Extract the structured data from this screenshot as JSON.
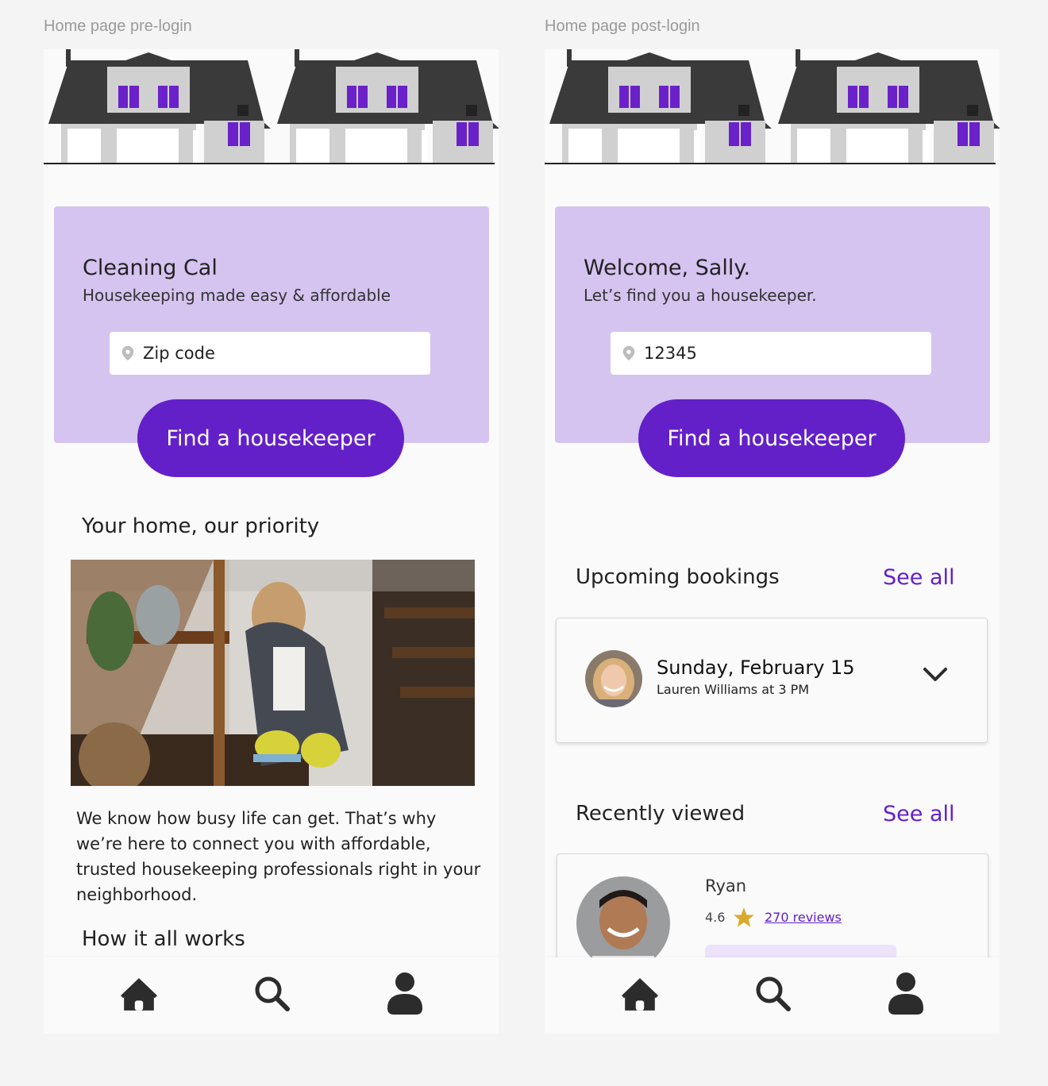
{
  "frames": {
    "pre": {
      "label": "Home page pre-login",
      "hero_title": "Cleaning Cal",
      "hero_subtitle": "Housekeeping made easy & affordable",
      "zip_placeholder": "Zip code",
      "cta": "Find a housekeeper",
      "section_title": "Your home, our priority",
      "body": "We know how busy life can get. That’s why we’re here to connect you with affordable, trusted housekeeping professionals right in your neighborhood.",
      "section2_title": "How it all works"
    },
    "post": {
      "label": "Home page post-login",
      "hero_title": "Welcome, Sally.",
      "hero_subtitle": "Let’s find you a housekeeper.",
      "zip_value": "12345",
      "cta": "Find a housekeeper",
      "upcoming": {
        "title": "Upcoming bookings",
        "see_all": "See all",
        "booking_date": "Sunday, February 15",
        "booking_detail": "Lauren Williams at 3 PM"
      },
      "recent": {
        "title": "Recently viewed",
        "see_all": "See all",
        "name": "Ryan",
        "rating": "4.6",
        "reviews": "270 reviews"
      }
    }
  },
  "nav_icons": [
    "home-icon",
    "search-icon",
    "profile-icon"
  ],
  "colors": {
    "accent": "#6320c8",
    "hero_bg": "#d5c3f0",
    "roof": "#3a3a3a",
    "wall": "#d0d0d0",
    "window": "#6b21c9",
    "star": "#d8a92a"
  }
}
